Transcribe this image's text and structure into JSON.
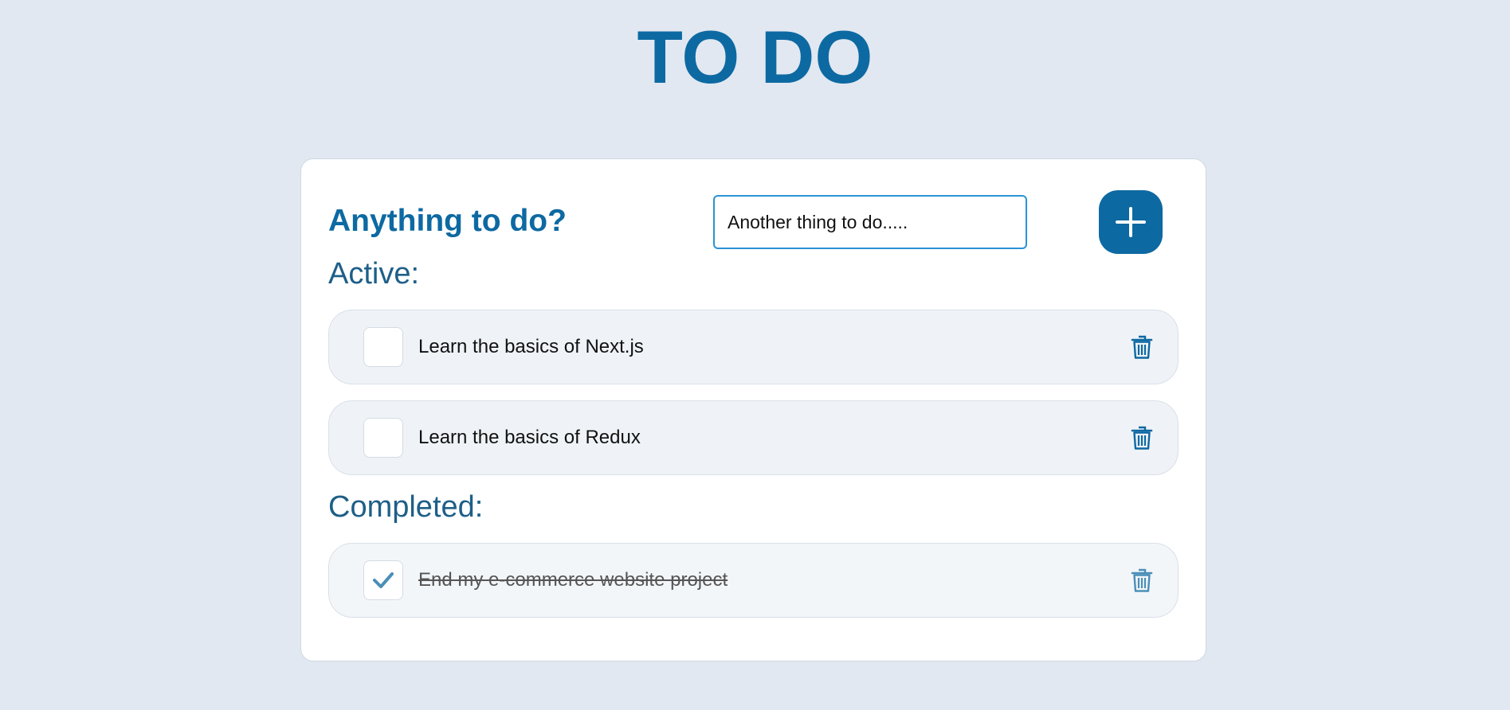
{
  "header": {
    "title": "TO DO"
  },
  "form": {
    "prompt": "Anything to do?",
    "input_placeholder": "Another thing to do.....",
    "add_icon": "plus-icon"
  },
  "sections": {
    "active_label": "Active:",
    "completed_label": "Completed:"
  },
  "active_items": [
    {
      "text": "Learn the basics of Next.js",
      "checked": false
    },
    {
      "text": "Learn the basics of Redux",
      "checked": false
    }
  ],
  "completed_items": [
    {
      "text": "End my e-commerce website project",
      "checked": true
    }
  ],
  "colors": {
    "background": "#e1e8f1",
    "accent": "#0d69a2",
    "card": "#ffffff",
    "row": "#eff3f7"
  }
}
